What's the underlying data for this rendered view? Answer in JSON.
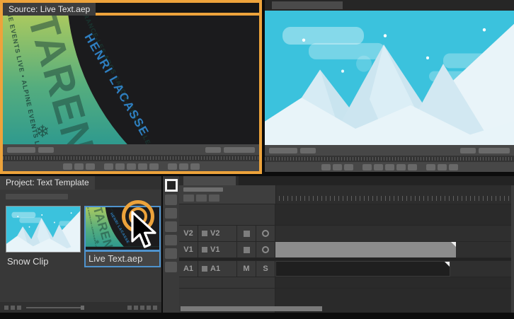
{
  "colors": {
    "highlight_orange": "#eda33b",
    "selection_blue": "#4f93cd",
    "sky_cyan": "#3bc2dd",
    "author_blue": "#2f7fc1"
  },
  "source_monitor": {
    "tab": "Source: Live Text.aep",
    "art": {
      "title": "TARENTAISE",
      "events_line": "NE EVENTS LIVE • ALPINE EVENTS LIVE • ALPINE EVENTS LIVE",
      "location_line": "FRANCE-LES ARCS SAVOIE, FRANCE-LES ARCS SAVOIE, FRANCE-LES ARCS",
      "author": "HENRI LACASSE",
      "snowflake_icon": "❄"
    }
  },
  "project_panel": {
    "tab": "Project: Text Template",
    "items": [
      {
        "label": "Snow Clip"
      },
      {
        "label": "Live Text.aep"
      }
    ]
  },
  "timeline": {
    "tracks": [
      {
        "name": "V2",
        "name2": "V2"
      },
      {
        "name": "V1",
        "name2": "V1"
      },
      {
        "name": "A1",
        "name2": "A1",
        "mute": "M",
        "solo": "S"
      }
    ]
  }
}
